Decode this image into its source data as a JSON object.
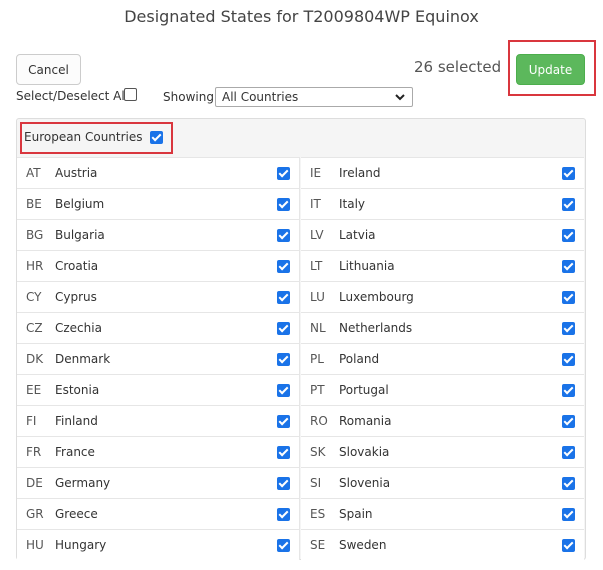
{
  "title": "Designated States for T2009804WP Equinox",
  "toolbar": {
    "cancel_label": "Cancel",
    "selected_text": "26 selected",
    "update_label": "Update",
    "select_all_label": "Select/Deselect All",
    "select_all_checked": false,
    "showing_label": "Showing:",
    "showing_value": "All Countries"
  },
  "group": {
    "label": "European Countries",
    "checked": true
  },
  "countries_left": [
    {
      "code": "AT",
      "name": "Austria",
      "checked": true
    },
    {
      "code": "BE",
      "name": "Belgium",
      "checked": true
    },
    {
      "code": "BG",
      "name": "Bulgaria",
      "checked": true
    },
    {
      "code": "HR",
      "name": "Croatia",
      "checked": true
    },
    {
      "code": "CY",
      "name": "Cyprus",
      "checked": true
    },
    {
      "code": "CZ",
      "name": "Czechia",
      "checked": true
    },
    {
      "code": "DK",
      "name": "Denmark",
      "checked": true
    },
    {
      "code": "EE",
      "name": "Estonia",
      "checked": true
    },
    {
      "code": "FI",
      "name": "Finland",
      "checked": true
    },
    {
      "code": "FR",
      "name": "France",
      "checked": true
    },
    {
      "code": "DE",
      "name": "Germany",
      "checked": true
    },
    {
      "code": "GR",
      "name": "Greece",
      "checked": true
    },
    {
      "code": "HU",
      "name": "Hungary",
      "checked": true
    }
  ],
  "countries_right": [
    {
      "code": "IE",
      "name": "Ireland",
      "checked": true
    },
    {
      "code": "IT",
      "name": "Italy",
      "checked": true
    },
    {
      "code": "LV",
      "name": "Latvia",
      "checked": true
    },
    {
      "code": "LT",
      "name": "Lithuania",
      "checked": true
    },
    {
      "code": "LU",
      "name": "Luxembourg",
      "checked": true
    },
    {
      "code": "NL",
      "name": "Netherlands",
      "checked": true
    },
    {
      "code": "PL",
      "name": "Poland",
      "checked": true
    },
    {
      "code": "PT",
      "name": "Portugal",
      "checked": true
    },
    {
      "code": "RO",
      "name": "Romania",
      "checked": true
    },
    {
      "code": "SK",
      "name": "Slovakia",
      "checked": true
    },
    {
      "code": "SI",
      "name": "Slovenia",
      "checked": true
    },
    {
      "code": "ES",
      "name": "Spain",
      "checked": true
    },
    {
      "code": "SE",
      "name": "Sweden",
      "checked": true
    }
  ],
  "colors": {
    "update_button": "#5cb85c",
    "checkbox": "#1a73e8",
    "highlight": "#d9363e"
  }
}
